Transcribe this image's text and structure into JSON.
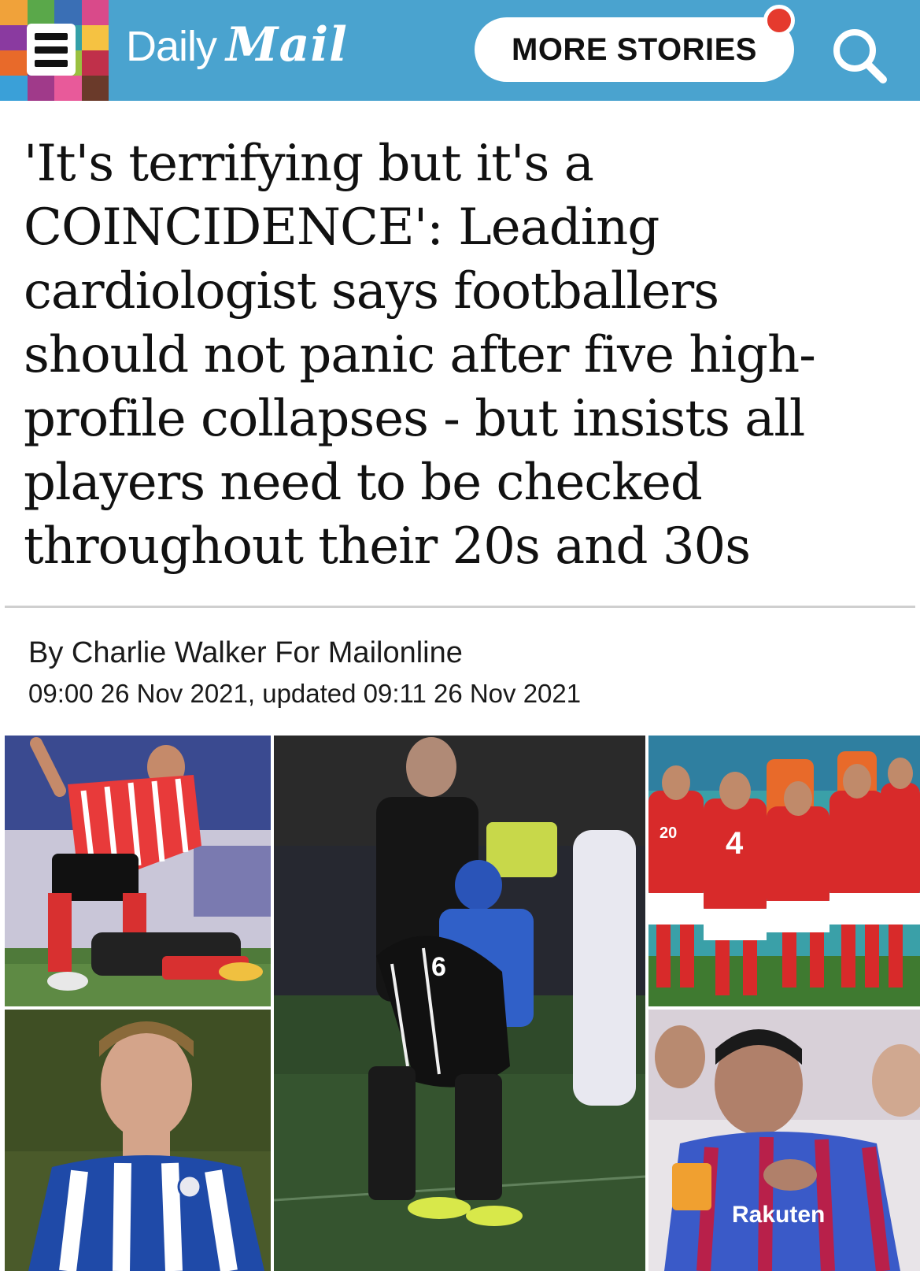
{
  "header": {
    "logo_daily": "Daily",
    "logo_mail": "Mail",
    "more_stories_label": "MORE STORIES",
    "brand_color": "#4aa3cf",
    "notification_color": "#e53a2e",
    "menu_icon": "hamburger-menu-icon",
    "search_icon": "search-icon"
  },
  "article": {
    "headline": "'It's terrifying but it's a COINCIDENCE': Leading cardiologist says footballers should not panic after five high-profile collapses - but insists all players need to be checked throughout their 20s and 30s",
    "byline": "By Charlie Walker For Mailonline",
    "timestamp": "09:00 26 Nov 2021, updated 09:11 26 Nov 2021"
  },
  "images": {
    "photo_1": {
      "caption_text": ""
    },
    "photo_2": {
      "shirt_number": "6"
    },
    "photo_3": {
      "shirt_number_front": "4",
      "shirt_number_left": "20"
    },
    "photo_5": {
      "shirt_sponsor": "Rakuten"
    }
  }
}
